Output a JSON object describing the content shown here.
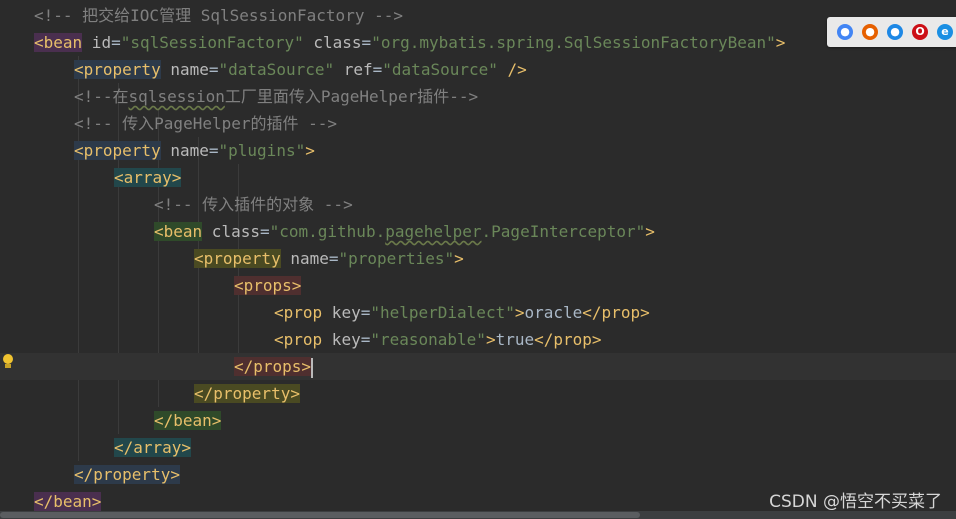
{
  "editor": {
    "lines": [
      {
        "indent": 0,
        "tokens": [
          {
            "cls": "c",
            "text": "<!-- 把交给IOC管理 SqlSessionFactory -->"
          }
        ]
      },
      {
        "indent": 0,
        "tokens": [
          {
            "cls": "t hl-purple",
            "text": "<bean"
          },
          {
            "cls": "a",
            "text": " id"
          },
          {
            "cls": "x",
            "text": "="
          },
          {
            "cls": "s",
            "text": "\"sqlSessionFactory\""
          },
          {
            "cls": "a",
            "text": " class"
          },
          {
            "cls": "x",
            "text": "="
          },
          {
            "cls": "s",
            "text": "\"org.mybatis.spring.SqlSessionFactoryBean\""
          },
          {
            "cls": "t",
            "text": ">"
          }
        ]
      },
      {
        "indent": 1,
        "tokens": [
          {
            "cls": "t hl-blue",
            "text": "<property"
          },
          {
            "cls": "a",
            "text": " name"
          },
          {
            "cls": "x",
            "text": "="
          },
          {
            "cls": "s",
            "text": "\"dataSource\""
          },
          {
            "cls": "a",
            "text": " ref"
          },
          {
            "cls": "x",
            "text": "="
          },
          {
            "cls": "s",
            "text": "\"dataSource\""
          },
          {
            "cls": "t",
            "text": " />"
          }
        ]
      },
      {
        "indent": 1,
        "tokens": [
          {
            "cls": "c",
            "text": "<!--在"
          },
          {
            "cls": "c squig",
            "text": "sqlsession"
          },
          {
            "cls": "c",
            "text": "工厂里面传入PageHelper插件-->"
          }
        ]
      },
      {
        "indent": 1,
        "tokens": [
          {
            "cls": "c",
            "text": "<!-- 传入PageHelper的插件 -->"
          }
        ]
      },
      {
        "indent": 1,
        "tokens": [
          {
            "cls": "t hl-blue",
            "text": "<property"
          },
          {
            "cls": "a",
            "text": " name"
          },
          {
            "cls": "x",
            "text": "="
          },
          {
            "cls": "s",
            "text": "\"plugins\""
          },
          {
            "cls": "t",
            "text": ">"
          }
        ]
      },
      {
        "indent": 2,
        "tokens": [
          {
            "cls": "t hl-teal",
            "text": "<array>"
          }
        ]
      },
      {
        "indent": 3,
        "tokens": [
          {
            "cls": "c",
            "text": "<!-- 传入插件的对象 -->"
          }
        ]
      },
      {
        "indent": 3,
        "tokens": [
          {
            "cls": "t hl-green",
            "text": "<bean"
          },
          {
            "cls": "a",
            "text": " class"
          },
          {
            "cls": "x",
            "text": "="
          },
          {
            "cls": "s",
            "text": "\"com.github."
          },
          {
            "cls": "s squig",
            "text": "pagehelper"
          },
          {
            "cls": "s",
            "text": ".PageInterceptor\""
          },
          {
            "cls": "t",
            "text": ">"
          }
        ]
      },
      {
        "indent": 4,
        "tokens": [
          {
            "cls": "t hl-olive",
            "text": "<property"
          },
          {
            "cls": "a",
            "text": " name"
          },
          {
            "cls": "x",
            "text": "="
          },
          {
            "cls": "s",
            "text": "\"properties\""
          },
          {
            "cls": "t",
            "text": ">"
          }
        ]
      },
      {
        "indent": 5,
        "tokens": [
          {
            "cls": "t hl-brown",
            "text": "<props>"
          }
        ]
      },
      {
        "indent": 6,
        "tokens": [
          {
            "cls": "t",
            "text": "<prop"
          },
          {
            "cls": "a",
            "text": " key"
          },
          {
            "cls": "x",
            "text": "="
          },
          {
            "cls": "s",
            "text": "\"helperDialect\""
          },
          {
            "cls": "t",
            "text": ">"
          },
          {
            "cls": "x",
            "text": "oracle"
          },
          {
            "cls": "t",
            "text": "</prop>"
          }
        ]
      },
      {
        "indent": 6,
        "tokens": [
          {
            "cls": "t",
            "text": "<prop"
          },
          {
            "cls": "a",
            "text": " key"
          },
          {
            "cls": "x",
            "text": "="
          },
          {
            "cls": "s",
            "text": "\"reasonable\""
          },
          {
            "cls": "t",
            "text": ">"
          },
          {
            "cls": "x",
            "text": "true"
          },
          {
            "cls": "t",
            "text": "</prop>"
          }
        ]
      },
      {
        "indent": 5,
        "current": true,
        "tokens": [
          {
            "cls": "t hl-brown",
            "text": "</props>"
          }
        ]
      },
      {
        "indent": 4,
        "tokens": [
          {
            "cls": "t hl-olive",
            "text": "</property>"
          }
        ]
      },
      {
        "indent": 3,
        "tokens": [
          {
            "cls": "t hl-green",
            "text": "</bean>"
          }
        ]
      },
      {
        "indent": 2,
        "tokens": [
          {
            "cls": "t hl-teal",
            "text": "</array>"
          }
        ]
      },
      {
        "indent": 1,
        "tokens": [
          {
            "cls": "t hl-blue",
            "text": "</property>"
          }
        ]
      },
      {
        "indent": 0,
        "tokens": [
          {
            "cls": "t hl-purple",
            "text": "</bean>"
          }
        ]
      }
    ]
  },
  "browser_icons": [
    {
      "name": "chrome-icon",
      "color": "#4285f4",
      "glyph": "●"
    },
    {
      "name": "firefox-icon",
      "color": "#e66000",
      "glyph": "●"
    },
    {
      "name": "safari-icon",
      "color": "#1e88e5",
      "glyph": "●"
    },
    {
      "name": "opera-icon",
      "color": "#cc0f16",
      "glyph": "O"
    },
    {
      "name": "edge-icon",
      "color": "#1a8fe3",
      "glyph": "e"
    }
  ],
  "watermark": "CSDN @悟空不买菜了",
  "colors": {
    "background": "#2b2b2b",
    "tag": "#e8bf6a",
    "attribute": "#bababa",
    "string": "#6a8759",
    "comment": "#808080",
    "text": "#a9b7c6"
  }
}
